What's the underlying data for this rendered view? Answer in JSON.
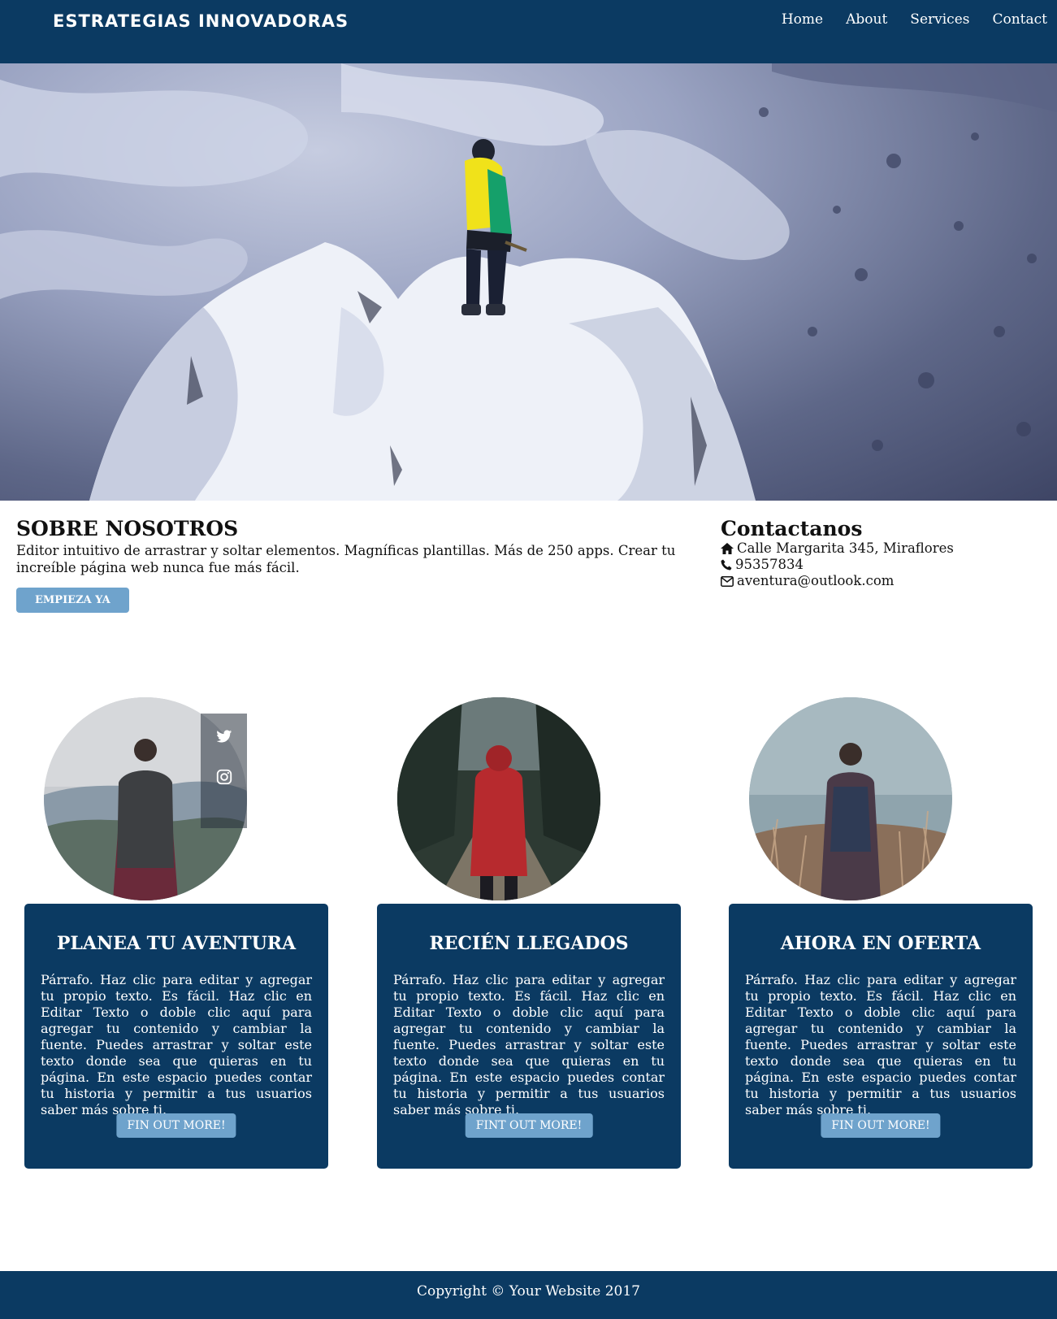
{
  "nav": {
    "brand": "ESTRATEGIAS INNOVADORAS",
    "links": [
      "Home",
      "About",
      "Services",
      "Contact"
    ]
  },
  "hero": {
    "image": "mountaineer-on-snowy-peak",
    "icon": "hero-image"
  },
  "about": {
    "title": "SOBRE NOSOTROS",
    "text": "Editor intuitivo de arrastrar y soltar elementos. Magníficas plantillas. Más de 250 apps. Crear tu increíble página web nunca fue más fácil.",
    "button": "EMPIEZA YA"
  },
  "contact": {
    "title": "Contactanos",
    "address": "Calle Margarita 345, Miraflores",
    "phone": "95357834",
    "email": "aventura@outlook.com",
    "icons": [
      "home-icon",
      "phone-icon",
      "envelope-icon"
    ]
  },
  "social": {
    "icons": [
      "twitter-icon",
      "instagram-icon"
    ]
  },
  "cards": [
    {
      "title": "PLANEA TU AVENTURA",
      "text": "Párrafo. Haz clic para editar y agregar tu propio texto. Es fácil. Haz clic en Editar Texto o doble clic aquí para agregar tu contenido y cambiar la fuente. Puedes arrastrar y soltar este texto donde sea que quieras en tu página. En este espacio puedes contar tu historia y permitir a tus usuarios saber más sobre ti.",
      "button": "FIN OUT MORE!",
      "image": "hiker-with-backpack-mountains"
    },
    {
      "title": "RECIÉN LLEGADOS",
      "text": "Párrafo. Haz clic para editar y agregar tu propio texto. Es fácil. Haz clic en Editar Texto o doble clic aquí para agregar tu contenido y cambiar la fuente. Puedes arrastrar y soltar este texto donde sea que quieras en tu página. En este espacio puedes contar tu historia y permitir a tus usuarios saber más sobre ti.",
      "button": "FINT OUT MORE!",
      "image": "person-red-hoodie-forest-road"
    },
    {
      "title": "AHORA EN OFERTA",
      "text": "Párrafo. Haz clic para editar y agregar tu propio texto. Es fácil. Haz clic en Editar Texto o doble clic aquí para agregar tu contenido y cambiar la fuente. Puedes arrastrar y soltar este texto donde sea que quieras en tu página. En este espacio puedes contar tu historia y permitir a tus usuarios saber más sobre ti.",
      "button": "FIN OUT MORE!",
      "image": "man-plaid-shirt-field"
    }
  ],
  "footer": {
    "text": "Copyright © Your Website 2017"
  },
  "colors": {
    "primary": "#0b3a62",
    "accent": "#6fa3cc",
    "text": "#111111",
    "white": "#ffffff"
  }
}
